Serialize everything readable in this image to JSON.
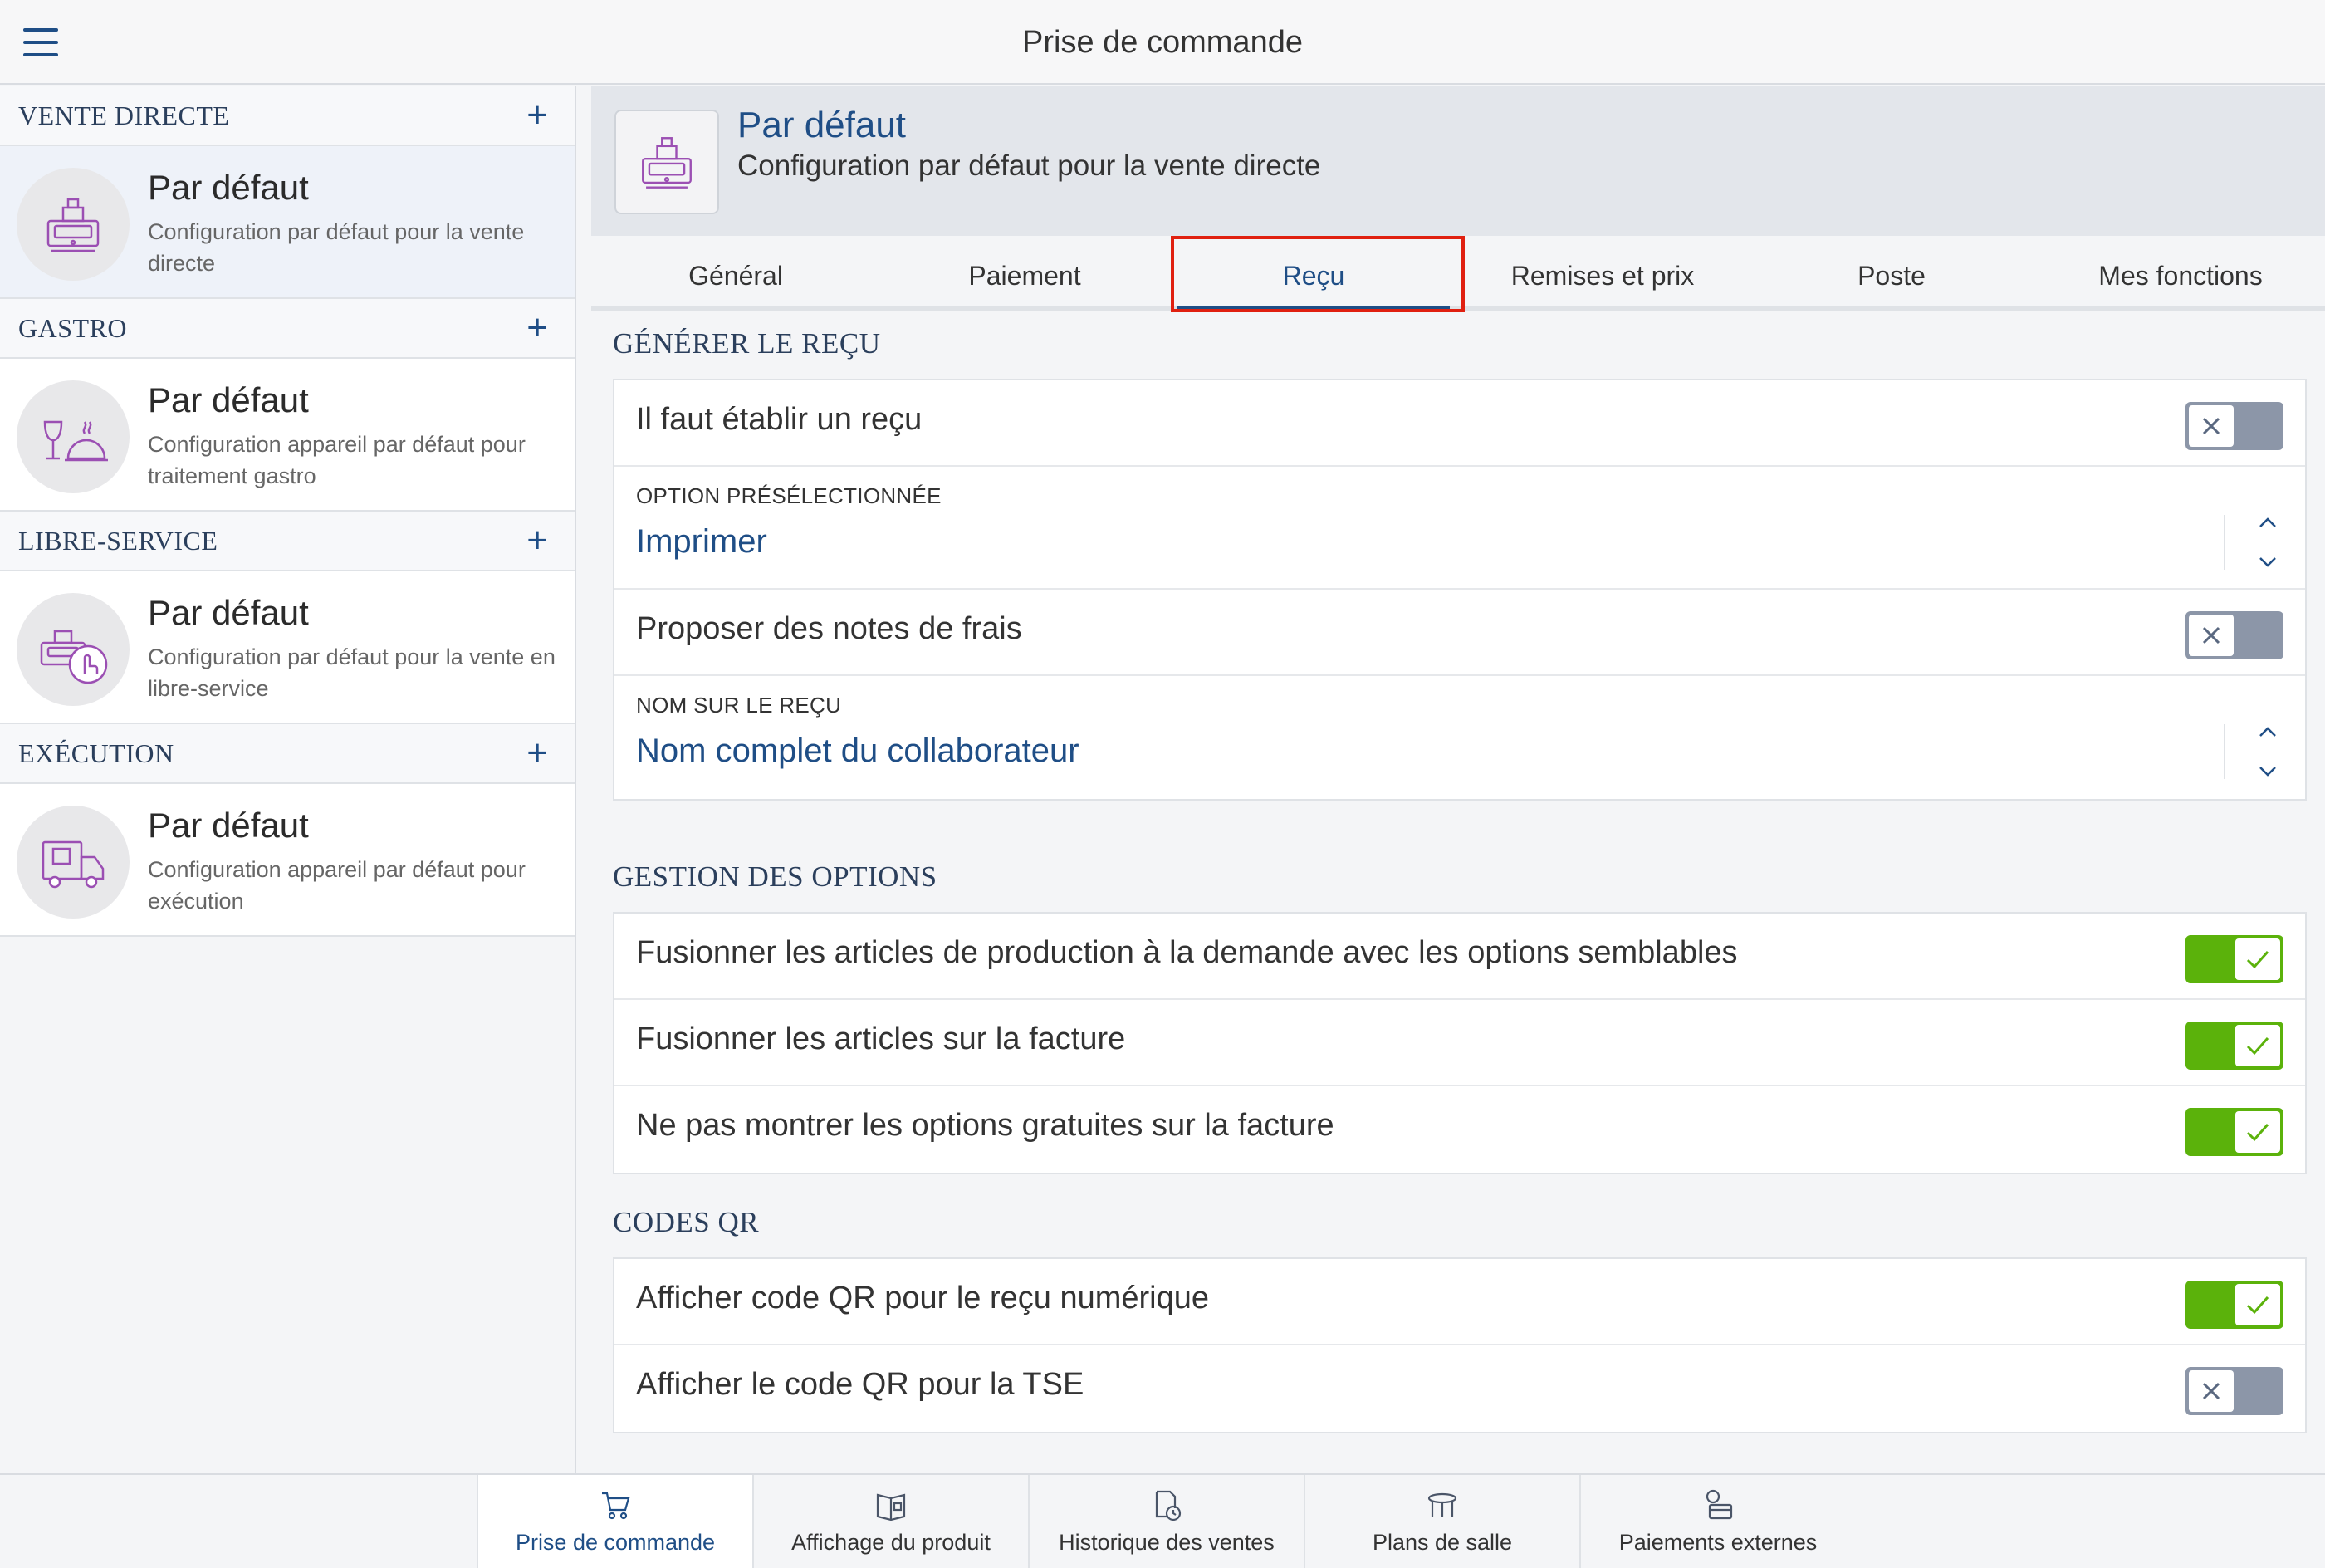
{
  "app": {
    "title": "Prise de commande"
  },
  "sidebar": {
    "sections": [
      {
        "label": "VENTE DIRECTE",
        "item": {
          "title": "Par défaut",
          "desc": "Configuration par défaut pour la vente directe"
        }
      },
      {
        "label": "GASTRO",
        "item": {
          "title": "Par défaut",
          "desc": "Configuration appareil par défaut pour traitement gastro"
        }
      },
      {
        "label": "LIBRE-SERVICE",
        "item": {
          "title": "Par défaut",
          "desc": "Configuration par défaut pour la vente en libre-service"
        }
      },
      {
        "label": "EXÉCUTION",
        "item": {
          "title": "Par défaut",
          "desc": "Configuration appareil par défaut pour exécution"
        }
      }
    ],
    "plus": "+"
  },
  "header": {
    "title": "Par défaut",
    "subtitle": "Configuration par défaut pour la vente directe"
  },
  "tabs": [
    {
      "label": "Général"
    },
    {
      "label": "Paiement"
    },
    {
      "label": "Reçu"
    },
    {
      "label": "Remises et prix"
    },
    {
      "label": "Poste"
    },
    {
      "label": "Mes fonctions"
    }
  ],
  "sections": {
    "generer": {
      "title": "GÉNÉRER LE REÇU",
      "row1": {
        "label": "Il faut établir un reçu",
        "on": false
      },
      "select1": {
        "caption": "OPTION PRÉSÉLECTIONNÉE",
        "value": "Imprimer"
      },
      "row2": {
        "label": "Proposer des notes de frais",
        "on": false
      },
      "select2": {
        "caption": "NOM SUR LE REÇU",
        "value": "Nom complet du collaborateur"
      }
    },
    "options": {
      "title": "GESTION DES OPTIONS",
      "rows": [
        {
          "label": "Fusionner les articles de production à la demande avec les options semblables",
          "on": true
        },
        {
          "label": "Fusionner les articles sur la facture",
          "on": true
        },
        {
          "label": "Ne pas montrer les options gratuites sur la facture",
          "on": true
        }
      ]
    },
    "qr": {
      "title": "CODES QR",
      "rows": [
        {
          "label": "Afficher code QR pour le reçu numérique",
          "on": true
        },
        {
          "label": "Afficher le code QR pour la TSE",
          "on": false
        }
      ]
    }
  },
  "bottom_nav": [
    {
      "label": "Prise de commande",
      "icon": "cart-icon"
    },
    {
      "label": "Affichage du produit",
      "icon": "product-display-icon"
    },
    {
      "label": "Historique des ventes",
      "icon": "sales-history-icon"
    },
    {
      "label": "Plans de salle",
      "icon": "table-icon"
    },
    {
      "label": "Paiements externes",
      "icon": "external-payment-icon"
    }
  ],
  "colors": {
    "accent": "#1f4e86",
    "toggle_on": "#5bb20b",
    "toggle_off": "#8c96a8",
    "highlight": "#e02010"
  }
}
